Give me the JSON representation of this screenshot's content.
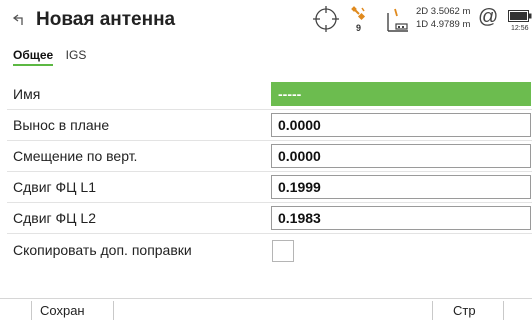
{
  "header": {
    "title": "Новая антенна",
    "satellites": "9",
    "precision_2d": "2D 3.5062 m",
    "precision_1d": "1D 4.9789 m",
    "at_symbol": "@",
    "clock": "12:56"
  },
  "tabs": [
    {
      "label": "Общее",
      "active": true
    },
    {
      "label": "IGS",
      "active": false
    }
  ],
  "form": {
    "name": {
      "label": "Имя",
      "value": "-----"
    },
    "horizontal_offset": {
      "label": "Вынос в плане",
      "value": "0.0000"
    },
    "vertical_offset": {
      "label": "Смещение по верт.",
      "value": "0.0000"
    },
    "pco_l1": {
      "label": "Сдвиг ФЦ L1",
      "value": "0.1999"
    },
    "pco_l2": {
      "label": "Сдвиг ФЦ L2",
      "value": "0.1983"
    },
    "copy_corrections": {
      "label": "Скопировать доп. поправки",
      "checked": false
    }
  },
  "softkeys": {
    "save": "Сохран",
    "page": "Стр"
  },
  "colors": {
    "accent_green": "#6cbc4f",
    "satellite_icon": "#e08a1e",
    "precision_icon": "#e08a1e"
  }
}
